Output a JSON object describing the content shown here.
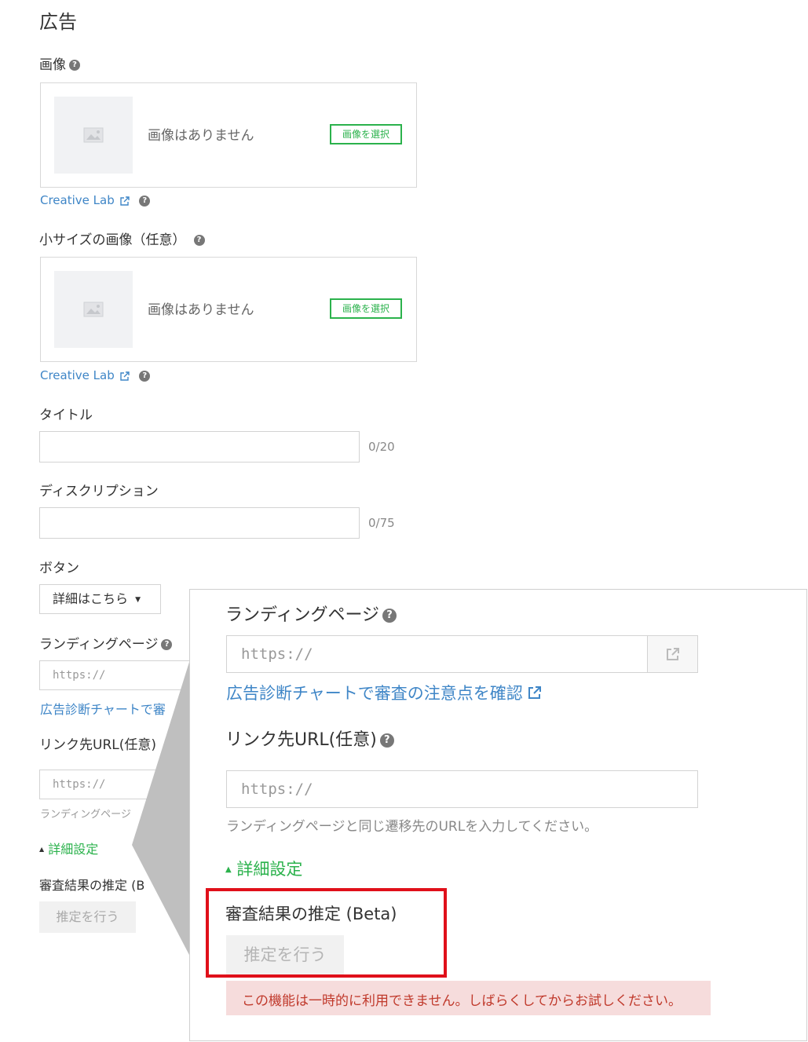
{
  "section_title": "広告",
  "image": {
    "label": "画像",
    "no_image": "画像はありません",
    "select_button": "画像を選択"
  },
  "creative_lab": "Creative Lab",
  "small_image": {
    "label": "小サイズの画像（任意）",
    "no_image": "画像はありません",
    "select_button": "画像を選択"
  },
  "creative_lab_2": "Creative Lab",
  "title_field": {
    "label": "タイトル",
    "counter": "0/20"
  },
  "description_field": {
    "label": "ディスクリプション",
    "counter": "0/75"
  },
  "button_field": {
    "label": "ボタン",
    "selected": "詳細はこちら"
  },
  "landing": {
    "label": "ランディングページ",
    "placeholder": "https://",
    "link": "広告診断チャートで審査の注意点を確認"
  },
  "link_url": {
    "label": "リンク先URL(任意)",
    "placeholder": "https://",
    "hint": "ランディングページと同じ遷移先のURLを入力してください。"
  },
  "advanced": "詳細設定",
  "estimate": {
    "label": "審査結果の推定 (Beta)",
    "button": "推定を行う",
    "error": "この機能は一時的に利用できません。しばらくしてからお試しください。"
  },
  "bg_clipped": {
    "landing_link": "広告診断チャートで審",
    "link_url_label": "リンク先URL(任意)",
    "hint_short": "ランディングページ",
    "estimate_label": "審査結果の推定 (B"
  },
  "colors": {
    "accent_green": "#2bb24c",
    "link_blue": "#3f86c7",
    "highlight_red": "#e0101a",
    "error_bg": "#f6dcdc"
  }
}
